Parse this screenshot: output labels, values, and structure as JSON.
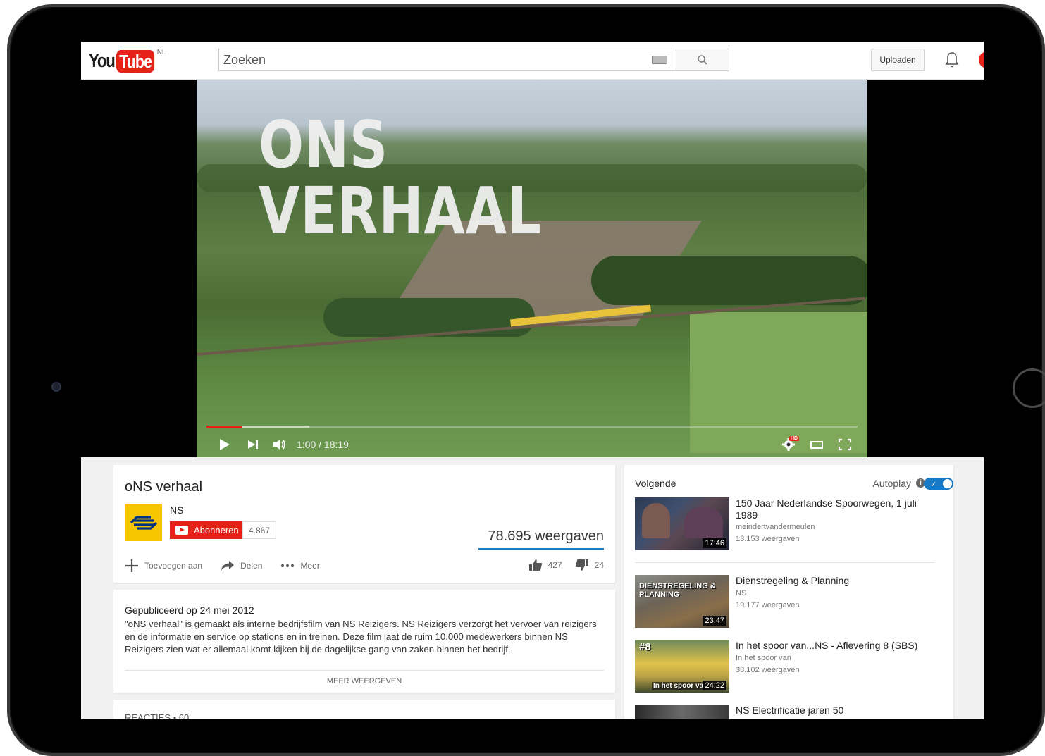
{
  "topbar": {
    "logo_you": "You",
    "logo_tube": "Tube",
    "logo_country": "NL",
    "search_placeholder": "Zoeken",
    "upload_label": "Uploaden"
  },
  "player": {
    "overlay_line1": "ONS",
    "overlay_line2": "VERHAAL",
    "time": "1:00 / 18:19",
    "played_fraction": 0.055,
    "buffered_fraction": 0.158,
    "hd_badge": "HD"
  },
  "video": {
    "title": "oNS verhaal",
    "channel": "NS",
    "subscribe_label": "Abonneren",
    "subscriber_count": "4.867",
    "views": "78.695 weergaven",
    "add_to_label": "Toevoegen aan",
    "share_label": "Delen",
    "more_label": "Meer",
    "likes": "427",
    "dislikes": "24"
  },
  "description": {
    "published": "Gepubliceerd op 24 mei 2012",
    "text": "\"oNS verhaal\" is gemaakt als interne bedrijfsfilm van NS Reizigers. NS Reizigers verzorgt het vervoer van reizigers en de informatie en service op stations en in treinen. Deze film laat de ruim 10.000 medewerkers binnen NS Reizigers zien wat er allemaal komt kijken bij de dagelijkse gang van zaken binnen het bedrijf.",
    "show_more": "MEER WEERGEVEN"
  },
  "comments": {
    "label": "REACTIES • 60"
  },
  "sidebar": {
    "next_label": "Volgende",
    "autoplay_label": "Autoplay",
    "recommendations": [
      {
        "title": "150 Jaar Nederlandse Spoorwegen, 1 juli 1989",
        "channel": "meindertvandermeulen",
        "views": "13.153 weergaven",
        "duration": "17:46"
      },
      {
        "title": "Dienstregeling & Planning",
        "channel": "NS",
        "views": "19.177 weergaven",
        "duration": "23:47",
        "thumb_text": "DIENSTREGELING & PLANNING"
      },
      {
        "title": "In het spoor van...NS - Aflevering 8 (SBS)",
        "channel": "In het spoor van",
        "views": "38.102 weergaven",
        "duration": "24:22",
        "thumb_badge": "#8",
        "thumb_caption": "In het spoor va"
      },
      {
        "title": "NS Electrificatie jaren 50"
      }
    ]
  },
  "colors": {
    "brand_red": "#e62117",
    "accent_blue": "#167ac6",
    "ns_yellow": "#f7c400",
    "ns_blue": "#003082"
  }
}
